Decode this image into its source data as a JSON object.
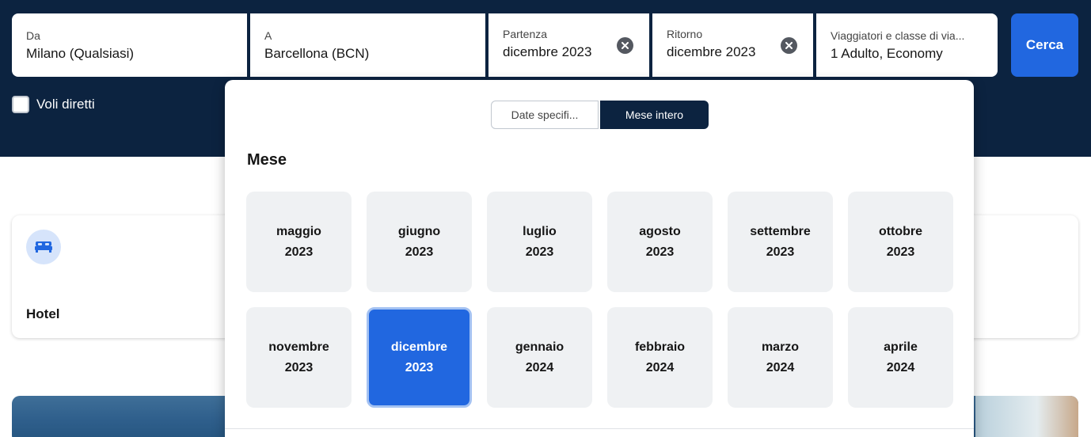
{
  "search": {
    "from": {
      "label": "Da",
      "value": "Milano (Qualsiasi)"
    },
    "to": {
      "label": "A",
      "value": "Barcellona (BCN)"
    },
    "departure": {
      "label": "Partenza",
      "value": "dicembre 2023"
    },
    "return": {
      "label": "Ritorno",
      "value": "dicembre 2023"
    },
    "travellers": {
      "label": "Viaggiatori e classe di via...",
      "value": "1 Adulto, Economy"
    },
    "button": "Cerca",
    "direct_flights": "Voli diretti"
  },
  "hotel_card": {
    "label": "Hotel",
    "icon": "bed-icon"
  },
  "picker": {
    "toggle": {
      "specific": "Date specifi...",
      "whole_month": "Mese intero",
      "active": "whole_month"
    },
    "title": "Mese",
    "months": [
      {
        "month": "maggio",
        "year": "2023"
      },
      {
        "month": "giugno",
        "year": "2023"
      },
      {
        "month": "luglio",
        "year": "2023"
      },
      {
        "month": "agosto",
        "year": "2023"
      },
      {
        "month": "settembre",
        "year": "2023"
      },
      {
        "month": "ottobre",
        "year": "2023"
      },
      {
        "month": "novembre",
        "year": "2023"
      },
      {
        "month": "dicembre",
        "year": "2023",
        "selected": true
      },
      {
        "month": "gennaio",
        "year": "2024"
      },
      {
        "month": "febbraio",
        "year": "2024"
      },
      {
        "month": "marzo",
        "year": "2024"
      },
      {
        "month": "aprile",
        "year": "2024"
      }
    ]
  },
  "colors": {
    "navy": "#0c2340",
    "primary": "#2167e0",
    "tile": "#eff1f3"
  }
}
